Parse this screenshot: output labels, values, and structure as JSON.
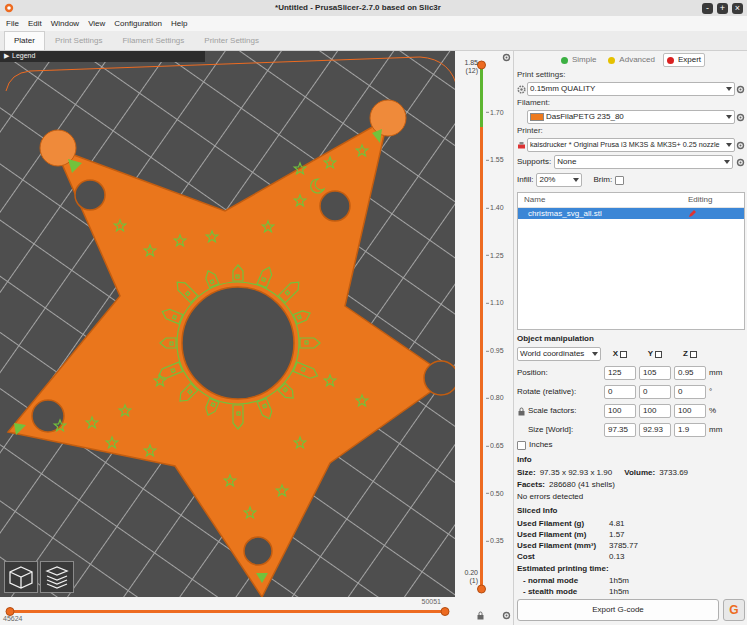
{
  "window": {
    "title": "*Untitled - PrusaSlicer-2.7.0 based on Slic3r",
    "controls": [
      "-",
      "+",
      "×"
    ]
  },
  "menu": [
    "File",
    "Edit",
    "Window",
    "View",
    "Configuration",
    "Help"
  ],
  "tabs": [
    {
      "label": "Plater",
      "selected": true
    },
    {
      "label": "Print Settings",
      "selected": false
    },
    {
      "label": "Filament Settings",
      "selected": false
    },
    {
      "label": "Printer Settings",
      "selected": false
    }
  ],
  "viewport": {
    "legend": {
      "arrow": "▶",
      "label": "Legend"
    }
  },
  "layer_slider": {
    "upper": {
      "value": "1.85",
      "layer": "(12)",
      "level": 1
    },
    "lower": {
      "value": "0.20",
      "layer": "(1)",
      "level": 0
    },
    "ticks": [
      "1.70",
      "1.55",
      "1.40",
      "1.25",
      "1.10",
      "0.95",
      "0.80",
      "0.65",
      "0.50",
      "0.35"
    ]
  },
  "move_slider": {
    "start": "45624",
    "end": "50051",
    "low": 0,
    "high": 1
  },
  "mode": [
    {
      "label": "Simple",
      "color": "#3cb043",
      "selected": false
    },
    {
      "label": "Advanced",
      "color": "#e5c100",
      "selected": false
    },
    {
      "label": "Expert",
      "color": "#d92020",
      "selected": true
    }
  ],
  "presets": [
    {
      "label": "Print settings:",
      "value": "0.15mm QUALITY",
      "kind": "print"
    },
    {
      "label": "Filament:",
      "value": "DasFilaPETG 235_80",
      "kind": "filament",
      "color": "#ed7a1e"
    },
    {
      "label": "Printer:",
      "value": "kaisdrucker * Original Prusa i3 MK3S & MK3S+ 0.25 nozzle",
      "kind": "printer"
    }
  ],
  "supports": {
    "label": "Supports:",
    "value": "None"
  },
  "infill": {
    "label": "Infill:",
    "value": "20%"
  },
  "brim": {
    "label": "Brim:",
    "checked": false
  },
  "objects": {
    "columns": [
      "Name",
      "Editing"
    ],
    "rows": [
      {
        "name": "christmas_svg_all.stl",
        "selected": true
      }
    ]
  },
  "manipulation": {
    "title": "Object manipulation",
    "coordinates": "World coordinates",
    "axes": [
      "X",
      "Y",
      "Z"
    ],
    "rows": [
      {
        "label": "Position:",
        "values": [
          "125",
          "105",
          "0.95"
        ],
        "unit": "mm"
      },
      {
        "label": "Rotate (relative):",
        "values": [
          "0",
          "0",
          "0"
        ],
        "unit": "°"
      },
      {
        "label": "Scale factors:",
        "values": [
          "100",
          "100",
          "100"
        ],
        "unit": "%"
      },
      {
        "label": "Size [World]:",
        "values": [
          "97.35",
          "92.93",
          "1.9"
        ],
        "unit": "mm"
      }
    ],
    "inches": {
      "label": "Inches",
      "checked": false
    }
  },
  "info": {
    "title": "Info",
    "size_label": "Size:",
    "size": "97.35 x 92.93 x 1.90",
    "volume_label": "Volume:",
    "volume": "3733.69",
    "facets_label": "Facets:",
    "facets": "286680 (41 shells)",
    "status": "No errors detected"
  },
  "sliced": {
    "title": "Sliced Info",
    "rows": [
      {
        "label": "Used Filament (g)",
        "value": "4.81"
      },
      {
        "label": "Used Filament (m)",
        "value": "1.57"
      },
      {
        "label": "Used Filament (mm³)",
        "value": "3785.77"
      },
      {
        "label": "Cost",
        "value": "0.13"
      }
    ],
    "time_title": "Estimated printing time:",
    "times": [
      {
        "label": "- normal mode",
        "value": "1h5m"
      },
      {
        "label": "- stealth mode",
        "value": "1h5m"
      }
    ]
  },
  "export": {
    "label": "Export G-code",
    "send": "G"
  }
}
